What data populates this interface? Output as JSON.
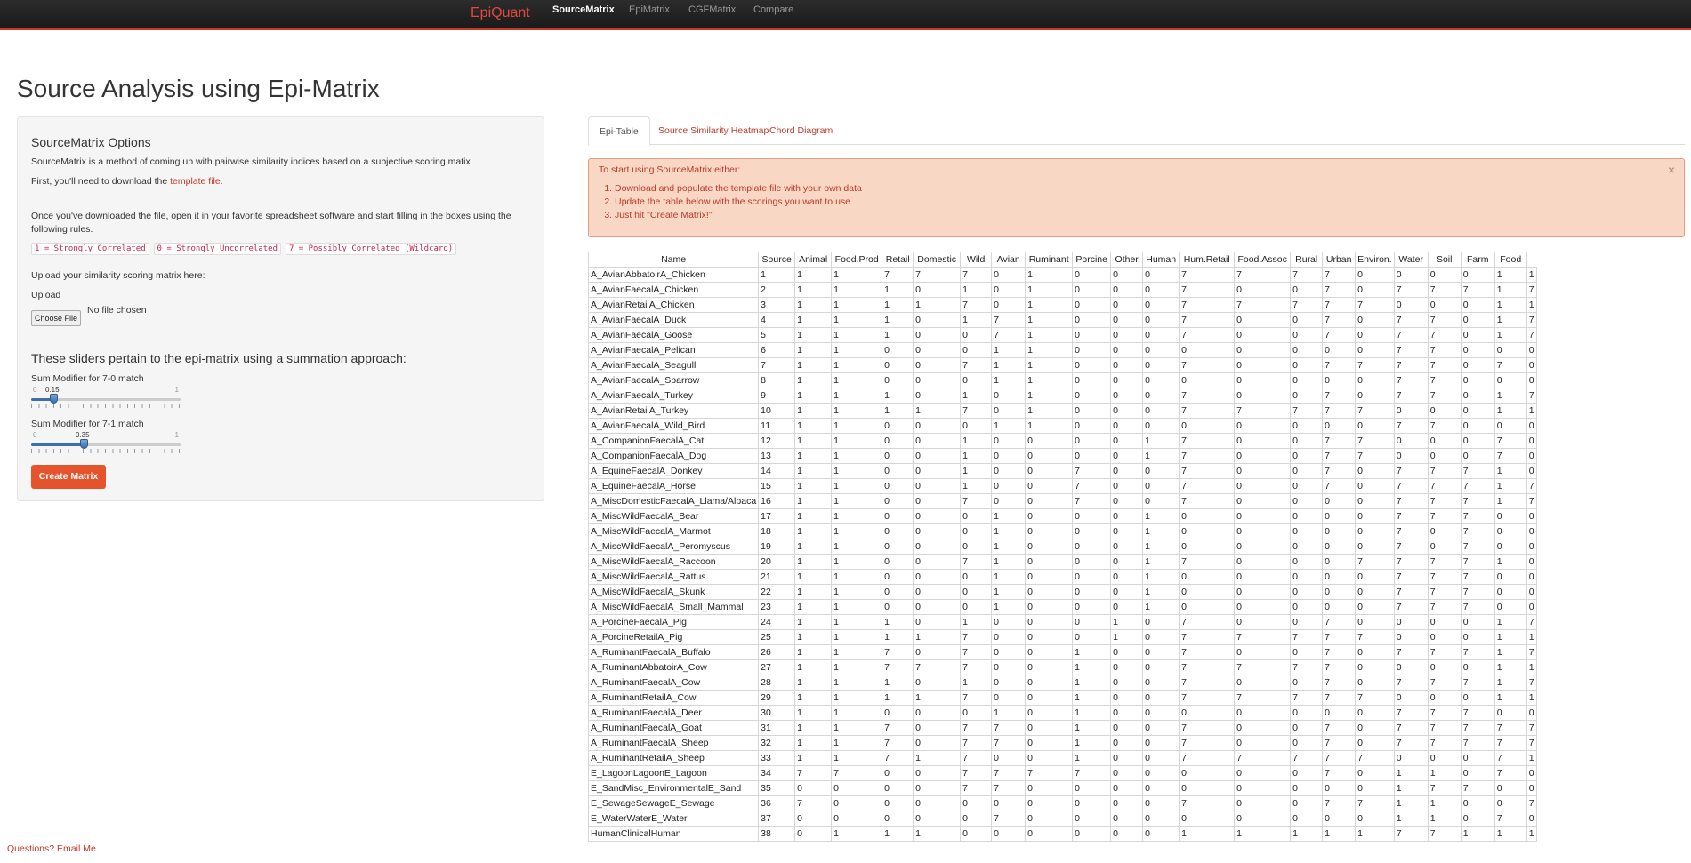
{
  "nav": {
    "brand": "EpiQuant",
    "links": [
      "SourceMatrix",
      "EpiMatrix",
      "CGFMatrix",
      "Compare"
    ]
  },
  "page_title": "Source Analysis using Epi-Matrix",
  "sidebar": {
    "title": "SourceMatrix Options",
    "desc": "SourceMatrix is a method of coming up with pairwise similarity indices based on a subjective scoring matix",
    "download_prefix": "First, you'll need to download the ",
    "download_link": "template file.",
    "instructions": "Once you've downloaded the file, open it in your favorite spreadsheet software and start filling in the boxes using the following rules.",
    "rules": [
      "1 = Strongly Correlated",
      "0 = Strongly Uncorrelated",
      "7 = Possibly Correlated (Wildcard)"
    ],
    "upload_prompt": "Upload your similarity scoring matrix here:",
    "upload_label": "Upload",
    "choose_file": "Choose File",
    "file_status": "No file chosen",
    "sliders_title": "These sliders pertain to the epi-matrix using a summation approach:",
    "slider1": {
      "label": "Sum Modifier for 7-0 match",
      "min": "0",
      "max": "1",
      "value": "0.15",
      "fraction": 0.15
    },
    "slider2": {
      "label": "Sum Modifier for 7-1 match",
      "min": "0",
      "max": "1",
      "value": "0.35",
      "fraction": 0.35
    },
    "create_button": "Create Matrix"
  },
  "tabs": [
    "Epi-Table",
    "Source Similarity Heatmap",
    "Chord Diagram"
  ],
  "alert": {
    "heading": "To start using SourceMatrix either:",
    "items": [
      "Download and populate the template file with your own data",
      "Update the table below with the scorings you want to use",
      "Just hit \"Create Matrix!\""
    ],
    "close": "×"
  },
  "table": {
    "headers": [
      "Name",
      "Source",
      "Animal",
      "Food.Prod",
      "Retail",
      "Domestic",
      "Wild",
      "Avian",
      "Ruminant",
      "Porcine",
      "Other",
      "Human",
      "Hum.Retail",
      "Food.Assoc",
      "Rural",
      "Urban",
      "Environ.",
      "Water",
      "Soil",
      "Farm",
      "Food"
    ],
    "rows": [
      [
        "A_AvianAbbatoirA_Chicken",
        "1",
        "1",
        "1",
        "7",
        "7",
        "7",
        "0",
        "1",
        "0",
        "0",
        "0",
        "7",
        "7",
        "7",
        "7",
        "0",
        "0",
        "0",
        "0",
        "1",
        "1"
      ],
      [
        "A_AvianFaecalA_Chicken",
        "2",
        "1",
        "1",
        "1",
        "0",
        "1",
        "0",
        "1",
        "0",
        "0",
        "0",
        "7",
        "0",
        "0",
        "7",
        "0",
        "7",
        "7",
        "7",
        "1",
        "7"
      ],
      [
        "A_AvianRetailA_Chicken",
        "3",
        "1",
        "1",
        "1",
        "1",
        "7",
        "0",
        "1",
        "0",
        "0",
        "0",
        "7",
        "7",
        "7",
        "7",
        "7",
        "0",
        "0",
        "0",
        "1",
        "1"
      ],
      [
        "A_AvianFaecalA_Duck",
        "4",
        "1",
        "1",
        "1",
        "0",
        "1",
        "7",
        "1",
        "0",
        "0",
        "0",
        "7",
        "0",
        "0",
        "7",
        "0",
        "7",
        "7",
        "0",
        "1",
        "7"
      ],
      [
        "A_AvianFaecalA_Goose",
        "5",
        "1",
        "1",
        "1",
        "0",
        "0",
        "7",
        "1",
        "0",
        "0",
        "0",
        "7",
        "0",
        "0",
        "7",
        "0",
        "7",
        "7",
        "0",
        "1",
        "7"
      ],
      [
        "A_AvianFaecalA_Pelican",
        "6",
        "1",
        "1",
        "0",
        "0",
        "0",
        "1",
        "1",
        "0",
        "0",
        "0",
        "0",
        "0",
        "0",
        "0",
        "0",
        "7",
        "7",
        "0",
        "0",
        "0"
      ],
      [
        "A_AvianFaecalA_Seagull",
        "7",
        "1",
        "1",
        "0",
        "0",
        "7",
        "1",
        "1",
        "0",
        "0",
        "0",
        "7",
        "0",
        "0",
        "7",
        "7",
        "7",
        "7",
        "0",
        "7",
        "0"
      ],
      [
        "A_AvianFaecalA_Sparrow",
        "8",
        "1",
        "1",
        "0",
        "0",
        "0",
        "1",
        "1",
        "0",
        "0",
        "0",
        "0",
        "0",
        "0",
        "0",
        "0",
        "7",
        "7",
        "0",
        "0",
        "0"
      ],
      [
        "A_AvianFaecalA_Turkey",
        "9",
        "1",
        "1",
        "1",
        "0",
        "1",
        "0",
        "1",
        "0",
        "0",
        "0",
        "7",
        "0",
        "0",
        "7",
        "0",
        "7",
        "7",
        "0",
        "1",
        "7"
      ],
      [
        "A_AvianRetailA_Turkey",
        "10",
        "1",
        "1",
        "1",
        "1",
        "7",
        "0",
        "1",
        "0",
        "0",
        "0",
        "7",
        "7",
        "7",
        "7",
        "7",
        "0",
        "0",
        "0",
        "1",
        "1"
      ],
      [
        "A_AvianFaecalA_Wild_Bird",
        "11",
        "1",
        "1",
        "0",
        "0",
        "0",
        "1",
        "1",
        "0",
        "0",
        "0",
        "0",
        "0",
        "0",
        "0",
        "0",
        "7",
        "7",
        "0",
        "0",
        "0"
      ],
      [
        "A_CompanionFaecalA_Cat",
        "12",
        "1",
        "1",
        "0",
        "0",
        "1",
        "0",
        "0",
        "0",
        "0",
        "1",
        "7",
        "0",
        "0",
        "7",
        "7",
        "0",
        "0",
        "0",
        "7",
        "0"
      ],
      [
        "A_CompanionFaecalA_Dog",
        "13",
        "1",
        "1",
        "0",
        "0",
        "1",
        "0",
        "0",
        "0",
        "0",
        "1",
        "7",
        "0",
        "0",
        "7",
        "7",
        "0",
        "0",
        "0",
        "7",
        "0"
      ],
      [
        "A_EquineFaecalA_Donkey",
        "14",
        "1",
        "1",
        "0",
        "0",
        "1",
        "0",
        "0",
        "7",
        "0",
        "0",
        "7",
        "0",
        "0",
        "7",
        "0",
        "7",
        "7",
        "7",
        "1",
        "0"
      ],
      [
        "A_EquineFaecalA_Horse",
        "15",
        "1",
        "1",
        "0",
        "0",
        "1",
        "0",
        "0",
        "7",
        "0",
        "0",
        "7",
        "0",
        "0",
        "7",
        "0",
        "7",
        "7",
        "7",
        "1",
        "7"
      ],
      [
        "A_MiscDomesticFaecalA_Llama/Alpaca",
        "16",
        "1",
        "1",
        "0",
        "0",
        "7",
        "0",
        "0",
        "7",
        "0",
        "0",
        "7",
        "0",
        "0",
        "0",
        "0",
        "7",
        "7",
        "7",
        "1",
        "7"
      ],
      [
        "A_MiscWildFaecalA_Bear",
        "17",
        "1",
        "1",
        "0",
        "0",
        "0",
        "1",
        "0",
        "0",
        "0",
        "1",
        "0",
        "0",
        "0",
        "0",
        "0",
        "7",
        "7",
        "7",
        "0",
        "0"
      ],
      [
        "A_MiscWildFaecalA_Marmot",
        "18",
        "1",
        "1",
        "0",
        "0",
        "0",
        "1",
        "0",
        "0",
        "0",
        "1",
        "0",
        "0",
        "0",
        "0",
        "0",
        "7",
        "0",
        "7",
        "0",
        "0"
      ],
      [
        "A_MiscWildFaecalA_Peromyscus",
        "19",
        "1",
        "1",
        "0",
        "0",
        "0",
        "1",
        "0",
        "0",
        "0",
        "1",
        "0",
        "0",
        "0",
        "0",
        "0",
        "7",
        "0",
        "7",
        "0",
        "0"
      ],
      [
        "A_MiscWildFaecalA_Raccoon",
        "20",
        "1",
        "1",
        "0",
        "0",
        "7",
        "1",
        "0",
        "0",
        "0",
        "1",
        "7",
        "0",
        "0",
        "0",
        "7",
        "7",
        "7",
        "7",
        "1",
        "0"
      ],
      [
        "A_MiscWildFaecalA_Rattus",
        "21",
        "1",
        "1",
        "0",
        "0",
        "0",
        "1",
        "0",
        "0",
        "0",
        "1",
        "0",
        "0",
        "0",
        "0",
        "0",
        "7",
        "7",
        "7",
        "0",
        "0"
      ],
      [
        "A_MiscWildFaecalA_Skunk",
        "22",
        "1",
        "1",
        "0",
        "0",
        "0",
        "1",
        "0",
        "0",
        "0",
        "1",
        "0",
        "0",
        "0",
        "0",
        "0",
        "7",
        "7",
        "7",
        "0",
        "0"
      ],
      [
        "A_MiscWildFaecalA_Small_Mammal",
        "23",
        "1",
        "1",
        "0",
        "0",
        "0",
        "1",
        "0",
        "0",
        "0",
        "1",
        "0",
        "0",
        "0",
        "0",
        "0",
        "7",
        "7",
        "7",
        "0",
        "0"
      ],
      [
        "A_PorcineFaecalA_Pig",
        "24",
        "1",
        "1",
        "1",
        "0",
        "1",
        "0",
        "0",
        "0",
        "1",
        "0",
        "7",
        "0",
        "0",
        "7",
        "0",
        "0",
        "0",
        "0",
        "1",
        "7"
      ],
      [
        "A_PorcineRetailA_Pig",
        "25",
        "1",
        "1",
        "1",
        "1",
        "7",
        "0",
        "0",
        "0",
        "1",
        "0",
        "7",
        "7",
        "7",
        "7",
        "7",
        "0",
        "0",
        "0",
        "1",
        "1"
      ],
      [
        "A_RuminantFaecalA_Buffalo",
        "26",
        "1",
        "1",
        "7",
        "0",
        "7",
        "0",
        "0",
        "1",
        "0",
        "0",
        "7",
        "0",
        "0",
        "7",
        "0",
        "7",
        "7",
        "7",
        "1",
        "7"
      ],
      [
        "A_RuminantAbbatoirA_Cow",
        "27",
        "1",
        "1",
        "7",
        "7",
        "7",
        "0",
        "0",
        "1",
        "0",
        "0",
        "7",
        "7",
        "7",
        "7",
        "0",
        "0",
        "0",
        "0",
        "1",
        "1"
      ],
      [
        "A_RuminantFaecalA_Cow",
        "28",
        "1",
        "1",
        "1",
        "0",
        "1",
        "0",
        "0",
        "1",
        "0",
        "0",
        "7",
        "0",
        "0",
        "7",
        "0",
        "7",
        "7",
        "7",
        "1",
        "7"
      ],
      [
        "A_RuminantRetailA_Cow",
        "29",
        "1",
        "1",
        "1",
        "1",
        "7",
        "0",
        "0",
        "1",
        "0",
        "0",
        "7",
        "7",
        "7",
        "7",
        "7",
        "0",
        "0",
        "0",
        "1",
        "1"
      ],
      [
        "A_RuminantFaecalA_Deer",
        "30",
        "1",
        "1",
        "0",
        "0",
        "0",
        "1",
        "0",
        "1",
        "0",
        "0",
        "0",
        "0",
        "0",
        "0",
        "0",
        "7",
        "7",
        "7",
        "0",
        "0"
      ],
      [
        "A_RuminantFaecalA_Goat",
        "31",
        "1",
        "1",
        "7",
        "0",
        "7",
        "7",
        "0",
        "1",
        "0",
        "0",
        "7",
        "0",
        "0",
        "7",
        "0",
        "7",
        "7",
        "7",
        "7",
        "7"
      ],
      [
        "A_RuminantFaecalA_Sheep",
        "32",
        "1",
        "1",
        "7",
        "0",
        "7",
        "7",
        "0",
        "1",
        "0",
        "0",
        "7",
        "0",
        "0",
        "7",
        "0",
        "7",
        "7",
        "7",
        "7",
        "7"
      ],
      [
        "A_RuminantRetailA_Sheep",
        "33",
        "1",
        "1",
        "7",
        "1",
        "7",
        "0",
        "0",
        "1",
        "0",
        "0",
        "7",
        "7",
        "7",
        "7",
        "7",
        "0",
        "0",
        "0",
        "7",
        "1"
      ],
      [
        "E_LagoonLagoonE_Lagoon",
        "34",
        "7",
        "7",
        "0",
        "0",
        "7",
        "7",
        "7",
        "7",
        "0",
        "0",
        "0",
        "0",
        "0",
        "7",
        "0",
        "1",
        "1",
        "0",
        "7",
        "0"
      ],
      [
        "E_SandMisc_EnvironmentalE_Sand",
        "35",
        "0",
        "0",
        "0",
        "0",
        "7",
        "7",
        "0",
        "0",
        "0",
        "0",
        "0",
        "0",
        "0",
        "0",
        "0",
        "1",
        "7",
        "7",
        "0",
        "0"
      ],
      [
        "E_SewageSewageE_Sewage",
        "36",
        "7",
        "0",
        "0",
        "0",
        "0",
        "0",
        "0",
        "0",
        "0",
        "0",
        "7",
        "0",
        "0",
        "7",
        "7",
        "1",
        "1",
        "0",
        "0",
        "7"
      ],
      [
        "E_WaterWaterE_Water",
        "37",
        "0",
        "0",
        "0",
        "0",
        "0",
        "7",
        "0",
        "0",
        "0",
        "0",
        "0",
        "0",
        "0",
        "0",
        "0",
        "1",
        "1",
        "0",
        "7",
        "0"
      ],
      [
        "HumanClinicalHuman",
        "38",
        "0",
        "1",
        "1",
        "1",
        "0",
        "0",
        "0",
        "0",
        "0",
        "0",
        "1",
        "1",
        "1",
        "1",
        "1",
        "7",
        "7",
        "1",
        "1",
        "1"
      ]
    ]
  },
  "footer": "Questions? Email Me",
  "colors": {
    "accent": "#c0392b",
    "button": "#e5532d",
    "navbar": "#222222"
  }
}
